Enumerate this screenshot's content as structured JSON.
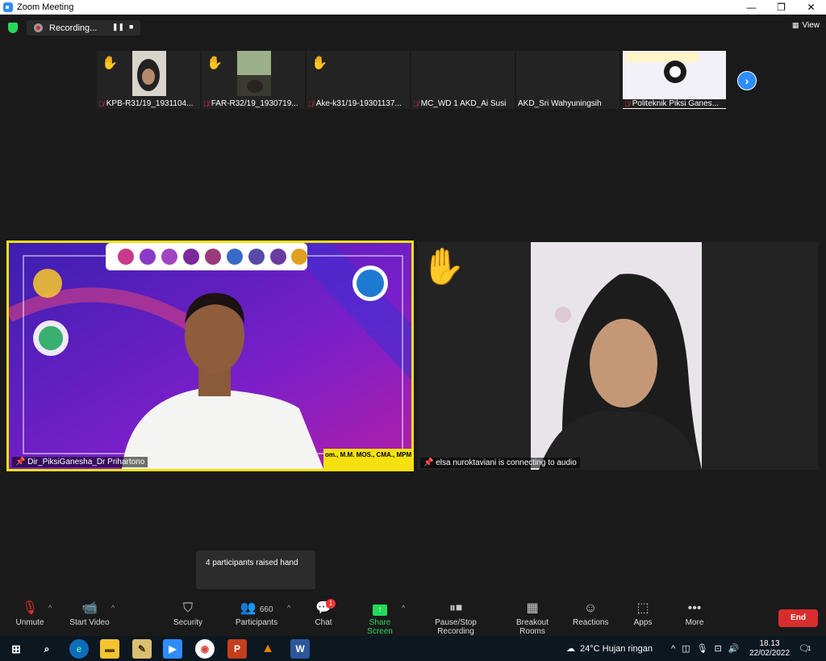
{
  "window": {
    "title": "Zoom Meeting",
    "minimize": "—",
    "restore": "❐",
    "close": "✕"
  },
  "topbar": {
    "recording_label": "Recording...",
    "pause_icon": "❚❚",
    "stop_icon": "■",
    "view_label": "View"
  },
  "participants_strip": [
    {
      "name": "KPB-R31/19_1931104...",
      "raised": true,
      "muted": true,
      "has_video": true
    },
    {
      "name": "FAR-R32/19_1930719...",
      "raised": true,
      "muted": true,
      "has_video": true
    },
    {
      "name": "Ake-k31/19-19301137...",
      "raised": true,
      "muted": true,
      "has_video": false
    },
    {
      "name": "MC_WD 1 AKD_Ai Susi",
      "raised": false,
      "muted": true,
      "has_video": false
    },
    {
      "name": "AKD_Sri Wahyuningsih",
      "raised": false,
      "muted": false,
      "has_video": false
    },
    {
      "name": "Politeknik Piksi Ganes...",
      "raised": false,
      "muted": true,
      "has_video": true
    }
  ],
  "strip_next": "›",
  "main_videos": {
    "left_name": "Dir_PiksiGanesha_Dr Prihartono",
    "left_banner": "om., M.M. MOS., CMA., MPM.",
    "right_name": "elsa nuroktaviani is connecting to audio"
  },
  "tooltip": "4 participants raised hand",
  "toolbar": {
    "unmute": "Unmute",
    "start_video": "Start Video",
    "security": "Security",
    "participants": "Participants",
    "participants_count": "660",
    "chat": "Chat",
    "chat_badge": "1",
    "share_screen": "Share Screen",
    "pause_stop_recording": "Pause/Stop Recording",
    "breakout_rooms": "Breakout Rooms",
    "reactions": "Reactions",
    "apps": "Apps",
    "more": "More",
    "end": "End"
  },
  "taskbar": {
    "weather": "24°C  Hujan ringan",
    "time": "18.13",
    "date": "22/02/2022",
    "notification_count": "1"
  },
  "colors": {
    "accent": "#2d8cff",
    "speaker_border": "#f5e10f",
    "end": "#d92d2d",
    "share": "#23d959"
  }
}
